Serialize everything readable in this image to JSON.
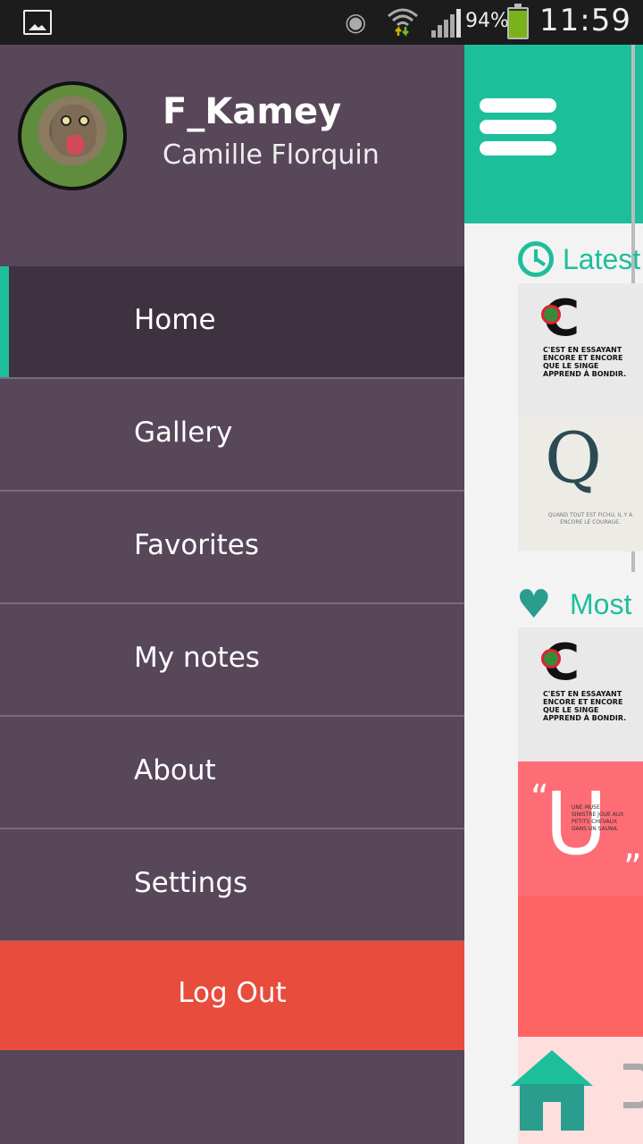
{
  "status": {
    "battery_pct": "94%",
    "time": "11:59",
    "battery_level": 0.94,
    "icons": [
      "image-notification-icon",
      "eye-icon",
      "wifi-icon",
      "signal-icon",
      "battery-icon"
    ]
  },
  "profile": {
    "username": "F_Kamey",
    "fullname": "Camille Florquin",
    "avatar": "cat-avatar"
  },
  "menu": {
    "items": [
      {
        "label": "Home",
        "active": true
      },
      {
        "label": "Gallery"
      },
      {
        "label": "Favorites"
      },
      {
        "label": "My notes"
      },
      {
        "label": "About"
      },
      {
        "label": "Settings"
      }
    ],
    "logout": "Log Out"
  },
  "content": {
    "latest_title": "Latest",
    "most_title": "Most",
    "quote1": "C'EST EN ESSAYANT ENCORE ET ENCORE QUE LE SINGE APPREND À BONDIR.",
    "quote2": "QUAND TOUT EST FICHU, IL Y A ENCORE LE COURAGE.",
    "quote3": "UNE MUSE SINISTRE JOUE AUX PETITS CHEVAUX DANS UN SAUNA.",
    "letter_c": "C",
    "letter_q": "Q",
    "letter_u": "U",
    "open_quote": "“",
    "close_quote": "”"
  },
  "colors": {
    "accent": "#1dbf9b",
    "drawer": "#574759",
    "active_item": "#3e3140",
    "logout": "#e84c3d",
    "pink": "#fe6c76"
  }
}
